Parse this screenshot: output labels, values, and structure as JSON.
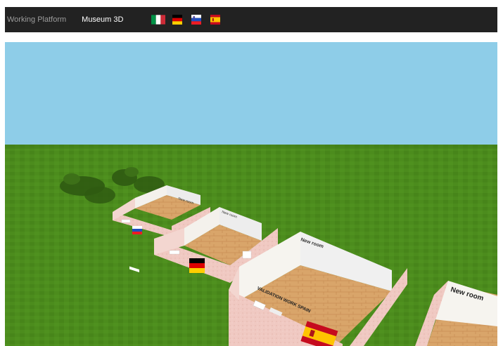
{
  "nav": {
    "brand": "Working Platform",
    "link": "Museum 3D",
    "background": "#222222",
    "flags": [
      {
        "name": "italy-flag",
        "colors": [
          "#009246",
          "#ffffff",
          "#ce2b37"
        ]
      },
      {
        "name": "germany-flag",
        "colors": [
          "#000000",
          "#dd0000",
          "#ffce00"
        ]
      },
      {
        "name": "slovenia-flag",
        "colors": [
          "#ffffff",
          "#1f4fbf",
          "#ed1c24"
        ]
      },
      {
        "name": "spain-flag",
        "colors": [
          "#c60b1e",
          "#ffc400",
          "#c60b1e"
        ]
      }
    ]
  },
  "scene": {
    "sky": "#8ecde8",
    "grass": "#4a8a1c",
    "rooms": [
      {
        "title": "",
        "wall_label": "New room"
      },
      {
        "title": "",
        "wall_label": "New room"
      },
      {
        "title": "VALIDATION WORK SPAIN",
        "wall_label": "New room"
      },
      {
        "title": "",
        "wall_label": "New room"
      }
    ]
  }
}
